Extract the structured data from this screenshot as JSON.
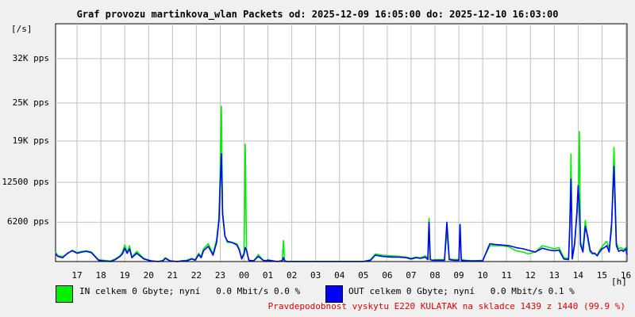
{
  "title": "Graf provozu martinkova_wlan Packets od: 2025-12-09 16:05:00 do: 2025-12-10 16:03:00",
  "legend": {
    "in_label": "IN celkem 0 Gbyte; nyní   0.0 Mbit/s 0.0 %",
    "out_label": "OUT celkem 0 Gbyte; nyní   0.0 Mbit/s 0.1 %"
  },
  "footer": {
    "text": "Pravdepodobnost vyskytu E220 KULATAK na skladce 1439 z 1440 (99.9 %)",
    "color": "#e00000"
  },
  "colors": {
    "in": "#00ee00",
    "out": "#0000ff",
    "grid": "#c0c0c0",
    "plot_bg": "#ffffff"
  },
  "chart_data": {
    "type": "line",
    "title": "Graf provozu martinkova_wlan Packets od: 2025-12-09 16:05:00 do: 2025-12-10 16:03:00",
    "unit_label": "[/s]",
    "x_unit_label": "[h]",
    "xlim": [
      16.1,
      40.05
    ],
    "ylim": [
      0,
      37500
    ],
    "ytick_values": [
      6200,
      12500,
      19000,
      25000,
      32000
    ],
    "ytick_labels": [
      "6200 pps",
      "12500 pps",
      "19K pps",
      "25K pps",
      "32K pps"
    ],
    "xtick_values": [
      17,
      18,
      19,
      20,
      21,
      22,
      23,
      24,
      25,
      26,
      27,
      28,
      29,
      30,
      31,
      32,
      33,
      34,
      35,
      36,
      37,
      38,
      39,
      40
    ],
    "xtick_labels": [
      "17",
      "18",
      "19",
      "20",
      "21",
      "22",
      "23",
      "00",
      "01",
      "02",
      "03",
      "04",
      "05",
      "06",
      "07",
      "08",
      "09",
      "10",
      "11",
      "12",
      "13",
      "14",
      "15",
      "16"
    ],
    "grid": true,
    "series": [
      {
        "name": "IN",
        "color": "#00ee00",
        "x": [
          16.1,
          16.2,
          16.4,
          16.6,
          16.8,
          17.0,
          17.2,
          17.4,
          17.6,
          17.9,
          18.1,
          18.4,
          18.6,
          18.8,
          18.9,
          19.0,
          19.1,
          19.2,
          19.3,
          19.5,
          19.8,
          20.1,
          20.4,
          20.6,
          20.7,
          20.9,
          21.2,
          21.4,
          21.6,
          21.8,
          21.95,
          22.1,
          22.2,
          22.3,
          22.5,
          22.7,
          22.85,
          22.95,
          23.0,
          23.05,
          23.1,
          23.2,
          23.3,
          23.5,
          23.7,
          23.8,
          23.9,
          24.0,
          24.05,
          24.1,
          24.2,
          24.4,
          24.6,
          24.8,
          24.9,
          25.0,
          25.2,
          25.4,
          25.6,
          25.65,
          25.7,
          25.8,
          26.5,
          27.5,
          28.5,
          29.0,
          29.3,
          29.5,
          29.8,
          30.2,
          30.5,
          30.8,
          31.0,
          31.2,
          31.4,
          31.6,
          31.7,
          31.75,
          31.8,
          31.9,
          32.0,
          32.4,
          32.5,
          32.6,
          32.8,
          33.0,
          33.05,
          33.1,
          33.3,
          33.6,
          34.0,
          34.3,
          34.5,
          34.8,
          35.1,
          35.4,
          35.7,
          35.9,
          36.2,
          36.5,
          36.8,
          37.0,
          37.2,
          37.4,
          37.6,
          37.65,
          37.7,
          37.75,
          37.85,
          37.95,
          38.0,
          38.05,
          38.1,
          38.2,
          38.3,
          38.4,
          38.5,
          38.6,
          38.7,
          38.8,
          38.9,
          39.0,
          39.1,
          39.2,
          39.3,
          39.4,
          39.5,
          39.6,
          39.7,
          39.8,
          39.9,
          40.0,
          40.05
        ],
        "values": [
          1500,
          900,
          800,
          1200,
          1800,
          1400,
          1600,
          1700,
          1500,
          300,
          200,
          100,
          400,
          900,
          1500,
          2600,
          1500,
          2500,
          700,
          1600,
          500,
          100,
          0,
          200,
          600,
          100,
          0,
          100,
          200,
          500,
          300,
          1300,
          800,
          2000,
          2800,
          1200,
          3500,
          7000,
          14500,
          24500,
          8000,
          4000,
          3000,
          3000,
          2800,
          2000,
          500,
          1500,
          18500,
          2000,
          200,
          100,
          1100,
          200,
          100,
          300,
          100,
          0,
          200,
          3300,
          100,
          0,
          0,
          0,
          0,
          0,
          300,
          1200,
          1000,
          900,
          800,
          700,
          500,
          700,
          600,
          900,
          400,
          6800,
          400,
          200,
          300,
          300,
          4700,
          400,
          300,
          300,
          5900,
          300,
          200,
          100,
          200,
          2500,
          2500,
          2500,
          2300,
          1700,
          1500,
          1200,
          1500,
          2500,
          2200,
          2000,
          2200,
          600,
          500,
          5000,
          17000,
          500,
          3000,
          7500,
          9000,
          20500,
          3000,
          2000,
          6500,
          3500,
          1500,
          1200,
          1200,
          1000,
          1800,
          2300,
          2800,
          3200,
          2000,
          5000,
          18000,
          3000,
          2000,
          2200,
          1800,
          2200,
          1200
        ],
        "note": ""
      },
      {
        "name": "OUT",
        "color": "#0000ff",
        "x": [
          16.1,
          16.2,
          16.4,
          16.6,
          16.8,
          17.0,
          17.2,
          17.4,
          17.6,
          17.9,
          18.1,
          18.4,
          18.6,
          18.8,
          18.9,
          19.0,
          19.1,
          19.2,
          19.3,
          19.5,
          19.8,
          20.1,
          20.4,
          20.6,
          20.7,
          20.9,
          21.2,
          21.4,
          21.6,
          21.8,
          21.95,
          22.1,
          22.2,
          22.3,
          22.5,
          22.7,
          22.85,
          22.95,
          23.0,
          23.05,
          23.1,
          23.2,
          23.3,
          23.5,
          23.7,
          23.8,
          23.9,
          24.0,
          24.05,
          24.1,
          24.2,
          24.4,
          24.6,
          24.8,
          24.9,
          25.0,
          25.2,
          25.4,
          25.6,
          25.65,
          25.7,
          25.8,
          26.5,
          27.5,
          28.5,
          29.0,
          29.3,
          29.5,
          29.8,
          30.2,
          30.5,
          30.8,
          31.0,
          31.2,
          31.4,
          31.6,
          31.7,
          31.75,
          31.8,
          31.9,
          32.0,
          32.4,
          32.5,
          32.6,
          32.8,
          33.0,
          33.05,
          33.1,
          33.3,
          33.6,
          34.0,
          34.3,
          34.5,
          34.8,
          35.1,
          35.4,
          35.7,
          35.9,
          36.2,
          36.5,
          36.8,
          37.0,
          37.2,
          37.4,
          37.6,
          37.65,
          37.7,
          37.75,
          37.85,
          37.95,
          38.0,
          38.05,
          38.1,
          38.2,
          38.3,
          38.4,
          38.5,
          38.6,
          38.7,
          38.8,
          38.9,
          39.0,
          39.1,
          39.2,
          39.3,
          39.4,
          39.5,
          39.6,
          39.7,
          39.8,
          39.9,
          40.0,
          40.05
        ],
        "values": [
          1200,
          800,
          600,
          1300,
          1700,
          1300,
          1500,
          1600,
          1400,
          200,
          100,
          0,
          300,
          800,
          1200,
          2100,
          1300,
          2000,
          600,
          1300,
          400,
          100,
          0,
          100,
          500,
          100,
          0,
          100,
          100,
          400,
          200,
          1100,
          600,
          1700,
          2400,
          1000,
          3000,
          6500,
          12000,
          17000,
          7500,
          4000,
          3200,
          3000,
          2600,
          1800,
          400,
          1200,
          2200,
          1800,
          200,
          100,
          800,
          200,
          100,
          200,
          100,
          0,
          100,
          600,
          100,
          0,
          0,
          0,
          0,
          0,
          200,
          1000,
          800,
          700,
          700,
          600,
          400,
          600,
          500,
          700,
          300,
          6200,
          300,
          200,
          200,
          200,
          6200,
          300,
          200,
          200,
          5800,
          200,
          100,
          100,
          100,
          2800,
          2700,
          2600,
          2500,
          2200,
          2000,
          1800,
          1500,
          2100,
          1800,
          1700,
          1800,
          400,
          300,
          5500,
          13000,
          400,
          2700,
          8000,
          12000,
          8500,
          2600,
          1500,
          5500,
          4000,
          1800,
          1300,
          1300,
          900,
          1500,
          2000,
          2200,
          2500,
          1500,
          6000,
          15000,
          2500,
          1600,
          1800,
          1600,
          2000,
          1100
        ],
        "note": ""
      }
    ]
  }
}
